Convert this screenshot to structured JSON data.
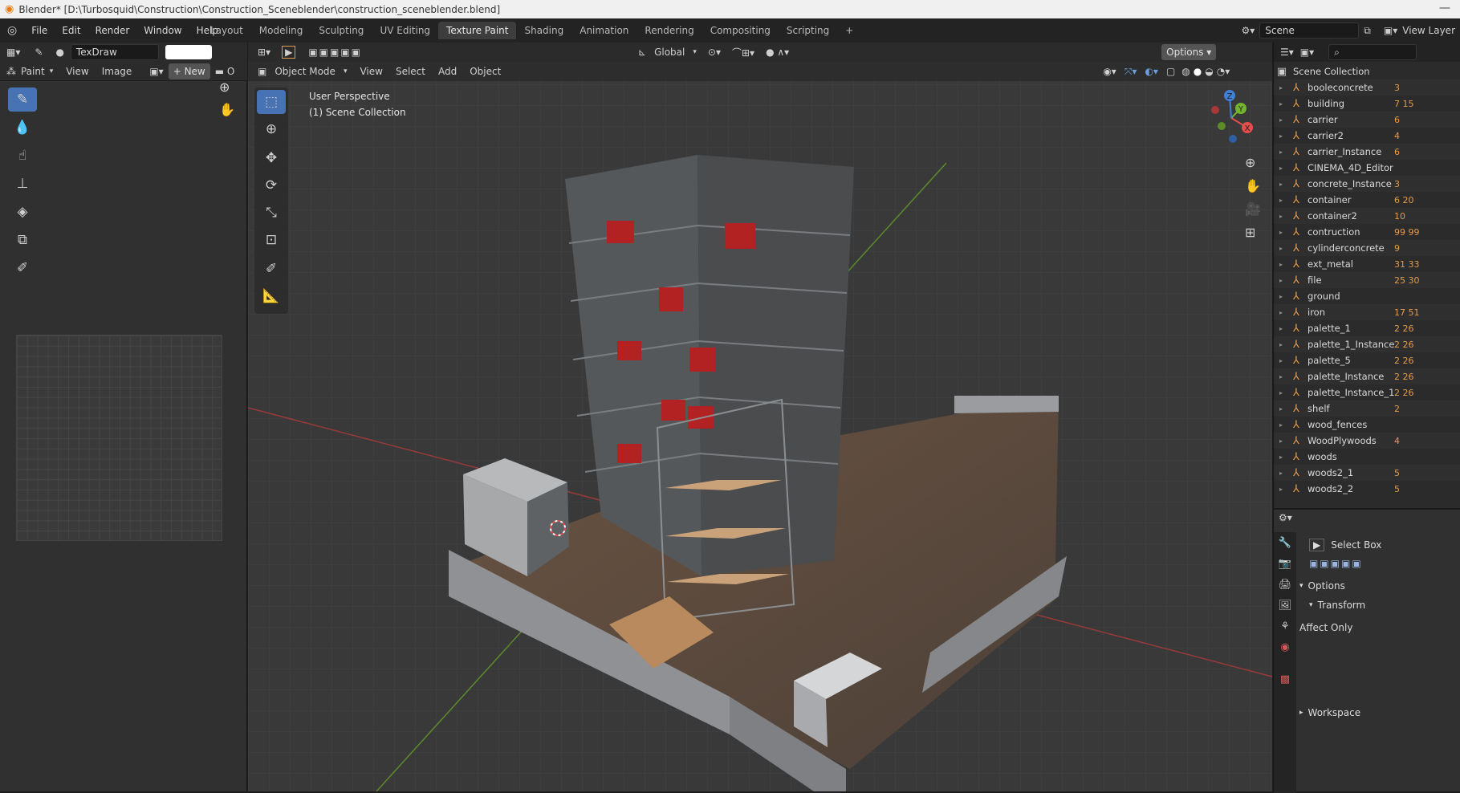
{
  "title": {
    "text": "Blender* [D:\\Turbosquid\\Construction\\Construction_Sceneblender\\construction_sceneblender.blend]"
  },
  "menu": {
    "items": [
      "File",
      "Edit",
      "Render",
      "Window",
      "Help"
    ]
  },
  "tabs": [
    "Layout",
    "Modeling",
    "Sculpting",
    "UV Editing",
    "Texture Paint",
    "Shading",
    "Animation",
    "Rendering",
    "Compositing",
    "Scripting"
  ],
  "active_tab": "Texture Paint",
  "scene": {
    "name": "Scene",
    "view_layer": "View Layer"
  },
  "image_editor": {
    "brush_name": "TexDraw",
    "mode": "Paint",
    "view_label": "View",
    "image_label": "Image",
    "new_label": "New",
    "open_label": "O"
  },
  "viewport": {
    "transform_orientation": "Global",
    "options_label": "Options",
    "mode": "Object Mode",
    "menu": [
      "View",
      "Select",
      "Add",
      "Object"
    ],
    "info_line1": "User Perspective",
    "info_line2": "(1) Scene Collection",
    "gizmo_axes": {
      "x": "X",
      "y": "Y",
      "z": "Z"
    }
  },
  "outliner": {
    "root": "Scene Collection",
    "items": [
      {
        "name": "booleconcrete",
        "badge": "3"
      },
      {
        "name": "building",
        "badge": "7 15"
      },
      {
        "name": "carrier",
        "badge": "6"
      },
      {
        "name": "carrier2",
        "badge": "4"
      },
      {
        "name": "carrier_Instance",
        "badge": "6"
      },
      {
        "name": "CINEMA_4D_Editor",
        "badge": ""
      },
      {
        "name": "concrete_Instance",
        "badge": "3"
      },
      {
        "name": "container",
        "badge": "6 20"
      },
      {
        "name": "container2",
        "badge": "10"
      },
      {
        "name": "contruction",
        "badge": "99 99"
      },
      {
        "name": "cylinderconcrete",
        "badge": "9"
      },
      {
        "name": "ext_metal",
        "badge": "31 33"
      },
      {
        "name": "file",
        "badge": "25 30"
      },
      {
        "name": "ground",
        "badge": ""
      },
      {
        "name": "iron",
        "badge": "17 51"
      },
      {
        "name": "palette_1",
        "badge": "2 26"
      },
      {
        "name": "palette_1_Instance",
        "badge": "2 26"
      },
      {
        "name": "palette_5",
        "badge": "2 26"
      },
      {
        "name": "palette_Instance",
        "badge": "2 26"
      },
      {
        "name": "palette_Instance_1",
        "badge": "2 26"
      },
      {
        "name": "shelf",
        "badge": "2"
      },
      {
        "name": "wood_fences",
        "badge": ""
      },
      {
        "name": "WoodPlywoods",
        "badge": "4"
      },
      {
        "name": "woods",
        "badge": ""
      },
      {
        "name": "woods2_1",
        "badge": "5"
      },
      {
        "name": "woods2_2",
        "badge": "5"
      }
    ]
  },
  "properties": {
    "tool_name": "Select Box",
    "options_label": "Options",
    "transform_label": "Transform",
    "affect_only_label": "Affect Only",
    "workspace_label": "Workspace"
  }
}
